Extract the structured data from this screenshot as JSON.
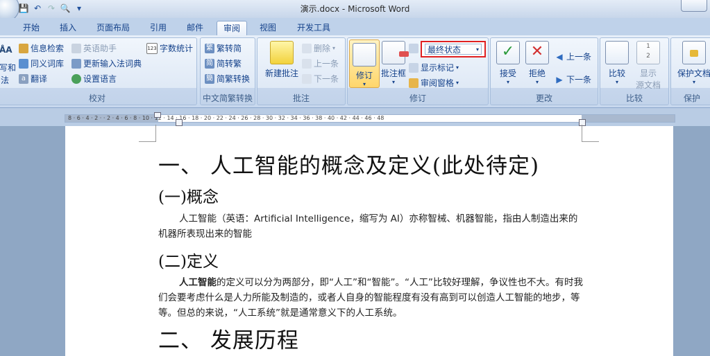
{
  "window": {
    "title": "演示.docx - Microsoft Word"
  },
  "tabs": [
    "开始",
    "插入",
    "页面布局",
    "引用",
    "邮件",
    "审阅",
    "视图",
    "开发工具"
  ],
  "active_tab": "审阅",
  "groups": {
    "proofing": {
      "label": "校对",
      "items": [
        "信息检索",
        "同义词库",
        "翻译",
        "英语助手",
        "更新输入法词典",
        "设置语言",
        "字数统计"
      ],
      "left_cut": [
        "写和",
        "法"
      ]
    },
    "chinese": {
      "label": "中文简繁转换",
      "items": [
        "繁转简",
        "简转繁",
        "简繁转换"
      ]
    },
    "comments": {
      "label": "批注",
      "new_comment": "新建批注",
      "delete": "删除",
      "prev": "上一条",
      "next": "下一条"
    },
    "tracking": {
      "label": "修订",
      "track": "修订",
      "balloons": "批注框",
      "display_for_review": "最终状态",
      "show_markup": "显示标记",
      "reviewing_pane": "审阅窗格"
    },
    "changes": {
      "label": "更改",
      "accept": "接受",
      "reject": "拒绝",
      "prev": "上一条",
      "next": "下一条"
    },
    "compare": {
      "label": "比较",
      "compare": "比较",
      "show_source_1": "显示",
      "show_source_2": "源文档"
    },
    "protect": {
      "label": "保护",
      "protect_doc": "保护文档"
    }
  },
  "ruler": {
    "marks": "8 · 6 · 4 · 2 ·   · 2 · 4 · 6 · 8 · 10 · 12 · 14 · 16 · 18 · 20 · 22 · 24 · 26 · 28 · 30 · 32 · 34 · 36 · 38 · 40 · 42 · 44 · 46 · 48"
  },
  "document": {
    "h1_a": "一、 人工智能的概念及定义(此处待定)",
    "h2_a": "(一)概念",
    "p1": "人工智能（英语：Artificial Intelligence，缩写为 AI）亦称智械、机器智能，指由人制造出来的机器所表现出来的智能",
    "h2_b": "(二)定义",
    "p2_bold": "人工智能",
    "p2_rest": "的定义可以分为两部分，即“人工”和“智能”。“人工”比较好理解，争议性也不大。有时我们会要考虑什么是人力所能及制造的，或者人自身的智能程度有没有高到可以创造人工智能的地步，等等。但总的来说，“人工系统”就是通常意义下的人工系统。",
    "h1_b": "二、 发展历程"
  },
  "colors": {
    "accent": "#15428b",
    "highlight_box": "#e02020"
  }
}
